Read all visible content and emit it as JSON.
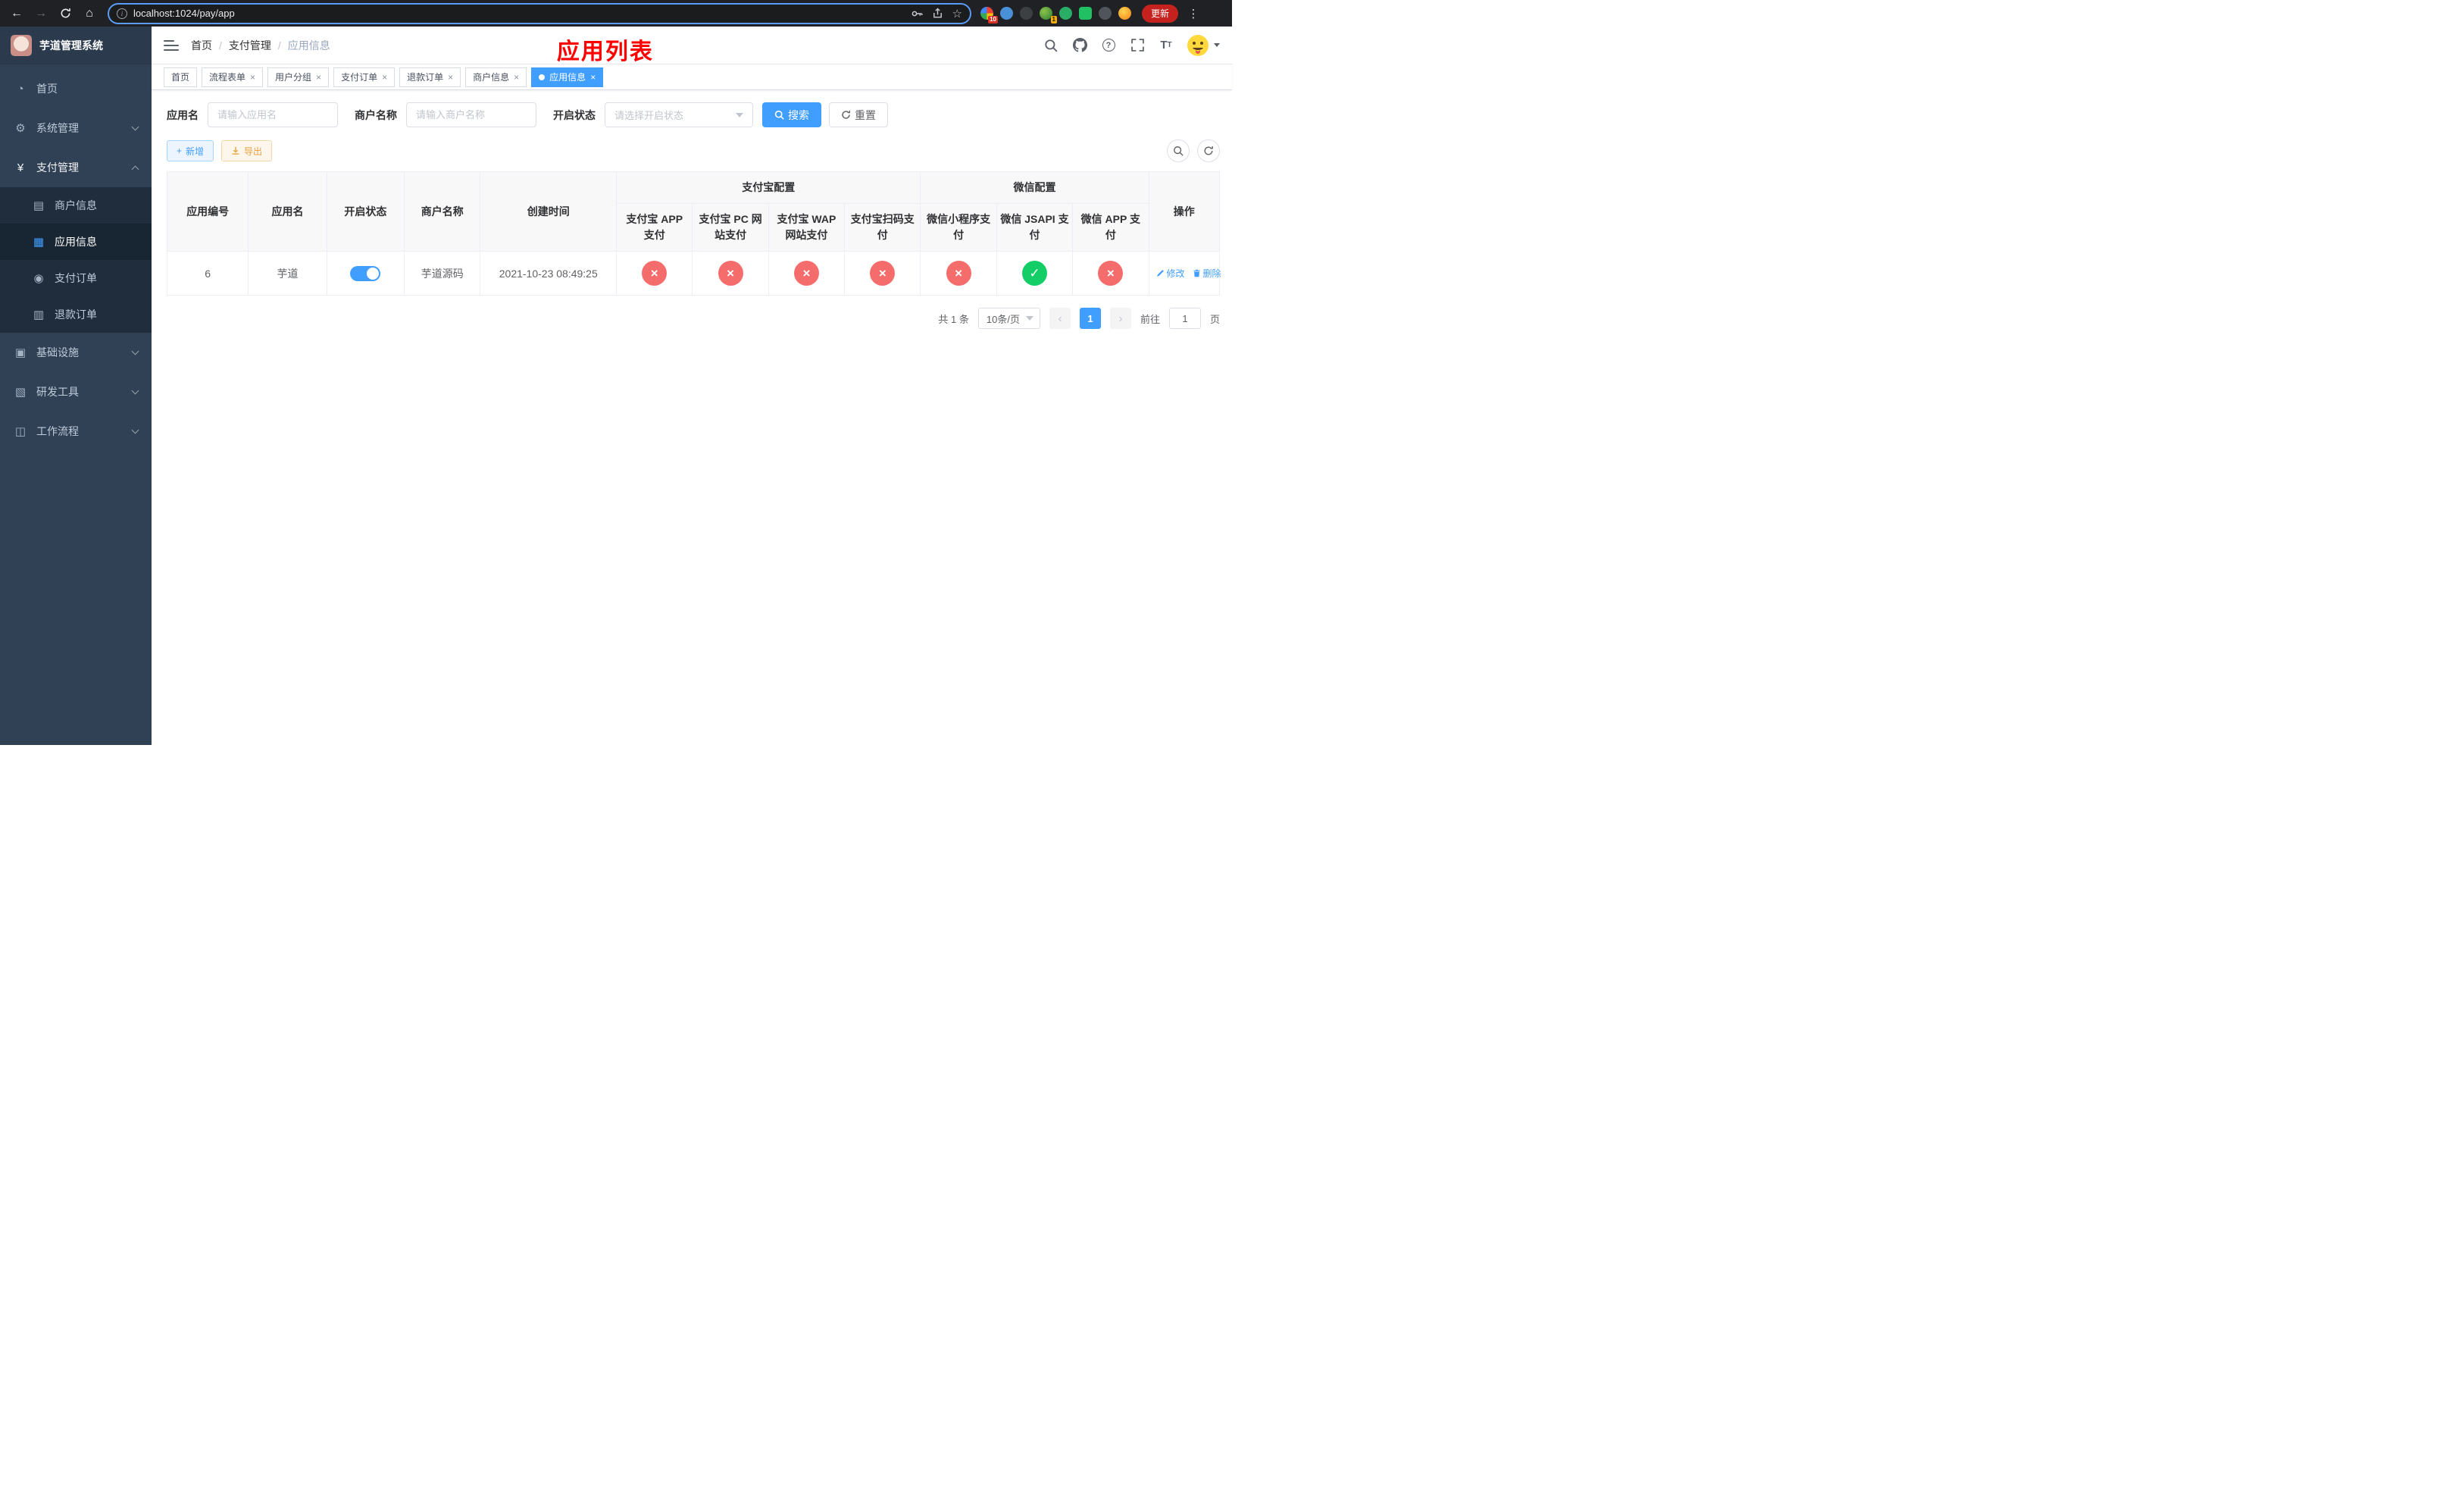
{
  "browser": {
    "url": "localhost:1024/pay/app",
    "update_label": "更新",
    "ext_badge_1": "10",
    "ext_badge_2": "1"
  },
  "sidebar": {
    "title": "芋道管理系统",
    "items": [
      {
        "label": "首页"
      },
      {
        "label": "系统管理"
      },
      {
        "label": "支付管理"
      },
      {
        "label": "基础设施"
      },
      {
        "label": "研发工具"
      },
      {
        "label": "工作流程"
      }
    ],
    "pay_children": [
      {
        "label": "商户信息"
      },
      {
        "label": "应用信息"
      },
      {
        "label": "支付订单"
      },
      {
        "label": "退款订单"
      }
    ]
  },
  "header": {
    "breadcrumb": [
      "首页",
      "支付管理",
      "应用信息"
    ],
    "title": "应用列表"
  },
  "tabs": [
    {
      "label": "首页"
    },
    {
      "label": "流程表单"
    },
    {
      "label": "用户分组"
    },
    {
      "label": "支付订单"
    },
    {
      "label": "退款订单"
    },
    {
      "label": "商户信息"
    },
    {
      "label": "应用信息"
    }
  ],
  "filters": {
    "app_name_label": "应用名",
    "app_name_placeholder": "请输入应用名",
    "merchant_label": "商户名称",
    "merchant_placeholder": "请输入商户名称",
    "status_label": "开启状态",
    "status_placeholder": "请选择开启状态",
    "search_label": "搜索",
    "reset_label": "重置"
  },
  "toolbar": {
    "add_label": "新增",
    "export_label": "导出"
  },
  "table": {
    "groups": {
      "alipay": "支付宝配置",
      "wechat": "微信配置"
    },
    "columns": [
      "应用编号",
      "应用名",
      "开启状态",
      "商户名称",
      "创建时间",
      "支付宝 APP 支付",
      "支付宝 PC 网站支付",
      "支付宝 WAP 网站支付",
      "支付宝扫码支付",
      "微信小程序支付",
      "微信 JSAPI 支付",
      "微信 APP 支付",
      "操作"
    ],
    "rows": [
      {
        "id": "6",
        "app_name": "芋道",
        "status_on": true,
        "merchant": "芋道源码",
        "created": "2021-10-23 08:49:25",
        "configs": [
          false,
          false,
          false,
          false,
          false,
          true,
          false
        ],
        "edit_label": "修改",
        "delete_label": "删除"
      }
    ]
  },
  "pagination": {
    "total": "共 1 条",
    "page_size": "10条/页",
    "current_page": "1",
    "goto_label": "前往",
    "goto_value": "1",
    "unit_label": "页"
  }
}
